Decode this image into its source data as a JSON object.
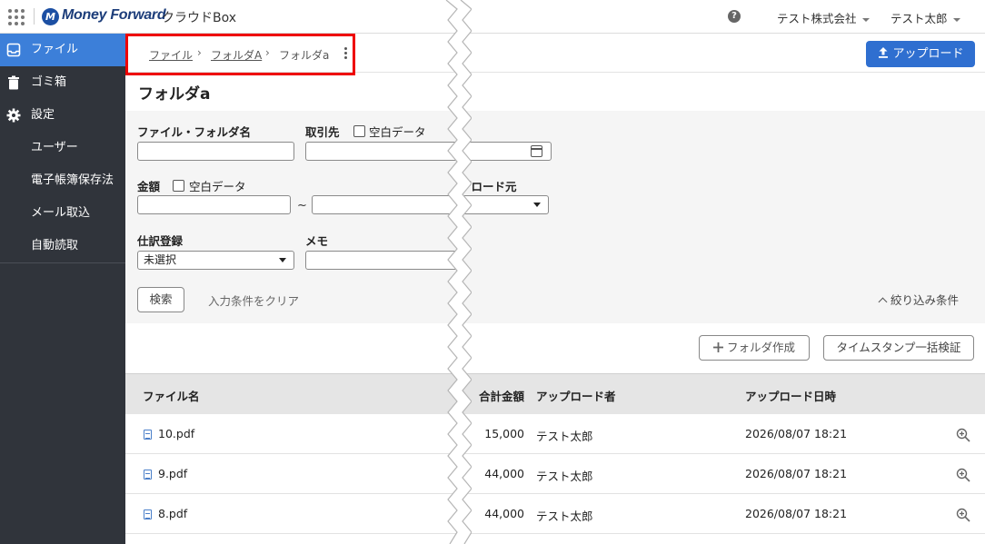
{
  "header": {
    "brand": "Money Forward",
    "product": "クラウドBox",
    "logo_mark": "M",
    "company": "テスト株式会社",
    "user": "テスト太郎",
    "help_glyph": "?"
  },
  "sidebar": {
    "items": [
      {
        "label": "ファイル",
        "icon": "inbox-icon"
      },
      {
        "label": "ゴミ箱",
        "icon": "trash-icon"
      },
      {
        "label": "設定",
        "icon": "gear-icon"
      },
      {
        "label": "ユーザー"
      },
      {
        "label": "電子帳簿保存法"
      },
      {
        "label": "メール取込"
      },
      {
        "label": "自動読取"
      }
    ]
  },
  "breadcrumb": {
    "items": [
      "ファイル",
      "フォルダA",
      "フォルダa"
    ]
  },
  "toolbar": {
    "upload_label": "アップロード"
  },
  "page": {
    "title": "フォルダa"
  },
  "filter": {
    "file_folder_name_label": "ファイル・フォルダ名",
    "partner_label": "取引先",
    "blank_data_label": "空白データ",
    "amount_label": "金額",
    "tilde": "~",
    "upload_source_label": "プロード元",
    "journal_label": "仕訳登録",
    "journal_value": "未選択",
    "memo_label": "メモ",
    "search_label": "検索",
    "clear_label": "入力条件をクリア",
    "narrow_label": "絞り込み条件"
  },
  "actions": {
    "create_folder_label": "フォルダ作成",
    "timestamp_label": "タイムスタンプ一括検証"
  },
  "table": {
    "columns": [
      "ファイル名",
      "合計金額",
      "アップロード者",
      "アップロード日時"
    ],
    "rows": [
      {
        "name": "10.pdf",
        "amount": "15,000",
        "uploader": "テスト太郎",
        "date": "2026/08/07 18:21"
      },
      {
        "name": "9.pdf",
        "amount": "44,000",
        "uploader": "テスト太郎",
        "date": "2026/08/07 18:21"
      },
      {
        "name": "8.pdf",
        "amount": "44,000",
        "uploader": "テスト太郎",
        "date": "2026/08/07 18:21"
      }
    ]
  },
  "colors": {
    "accent": "#2f6fd0",
    "sidebar_bg": "#30343b",
    "sidebar_active": "#3c7fd9",
    "highlight_border": "#e00000"
  }
}
